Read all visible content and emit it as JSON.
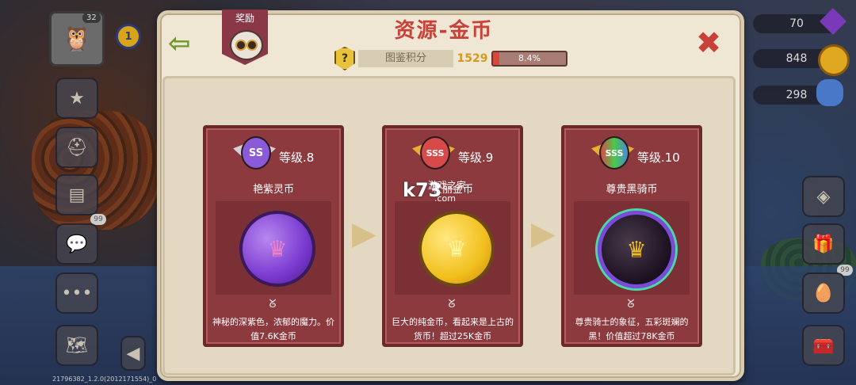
{
  "header": {
    "title": "资源-金币",
    "reward_label": "奖励"
  },
  "score": {
    "label": "图鉴积分",
    "value": "1529",
    "progress_text": "8.4%",
    "progress_fraction": 0.084,
    "help_symbol": "?"
  },
  "hud": {
    "player_level": "32",
    "rank_badge": "1",
    "resources": [
      {
        "value": "70",
        "icon": "purple-gem-icon"
      },
      {
        "value": "848",
        "icon": "gold-coin-icon"
      },
      {
        "value": "298",
        "icon": "blue-gem-icon"
      }
    ],
    "badge_count": "99",
    "version": "21796382_1.2.0(2012171554)_0"
  },
  "cards": [
    {
      "rank": "SS",
      "level": "等级.8",
      "name": "艳紫灵币",
      "desc": "神秘的深紫色，浓郁的魔力。价值7.6K金币",
      "coin_color": "#8a4ad8"
    },
    {
      "rank": "SSS",
      "level": "等级.9",
      "name": "壮丽金币",
      "desc": "巨大的纯金币，看起来是上古的货币！超过25K金币",
      "coin_color": "#f2c01e"
    },
    {
      "rank": "SSS",
      "level": "等级.10",
      "name": "尊贵黑骑币",
      "desc": "尊贵骑士的象征，五彩斑斓的黑！价值超过78K金币",
      "coin_color": "#3a2a3a"
    }
  ],
  "watermark": {
    "main": "k73",
    "sub": "游戏之家",
    "com": ".com"
  }
}
